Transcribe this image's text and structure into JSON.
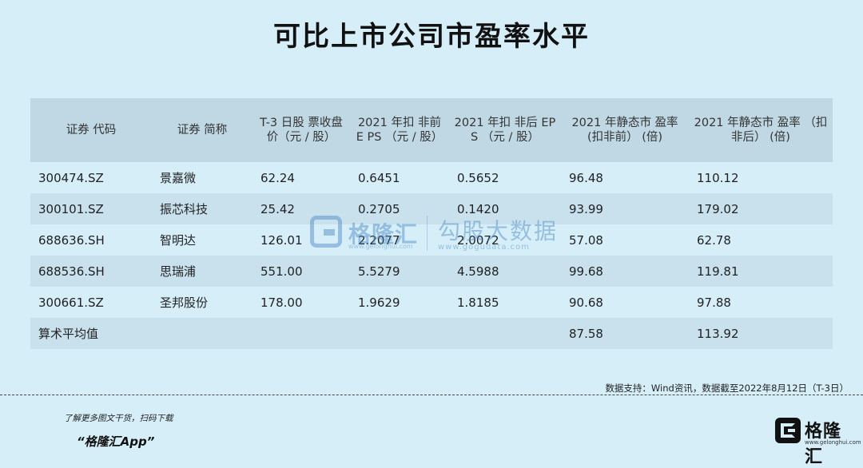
{
  "title": "可比上市公司市盈率水平",
  "table": {
    "headers": [
      "证券 代码",
      "证券 简称",
      "T-3 日股 票收盘 价（元 / 股）",
      "2021 年扣 非前 E PS （元 / 股）",
      "2021 年扣 非后 EP S （元 / 股）",
      "2021 年静态市 盈率 (扣非前） (倍)",
      "2021 年静态市 盈率 （扣 非后） (倍)"
    ],
    "rows": [
      [
        "300474.SZ",
        "景嘉微",
        "62.24",
        "0.6451",
        "0.5652",
        "96.48",
        "110.12"
      ],
      [
        "300101.SZ",
        "振芯科技",
        "25.42",
        "0.2705",
        "0.1420",
        "93.99",
        "179.02"
      ],
      [
        "688636.SH",
        "智明达",
        "126.01",
        "2.2077",
        "2.0072",
        "57.08",
        "62.78"
      ],
      [
        "688536.SH",
        "思瑞浦",
        "551.00",
        "5.5279",
        "4.5988",
        "99.68",
        "119.81"
      ],
      [
        "300661.SZ",
        "圣邦股份",
        "178.00",
        "1.9629",
        "1.8185",
        "90.68",
        "97.88"
      ]
    ],
    "average_row": {
      "label": "算术平均值",
      "static_pe_before": "87.58",
      "static_pe_after": "113.92"
    }
  },
  "watermark": {
    "name": "格隆汇",
    "sub": "勾股大数据",
    "url_left": "www.gelonghui.com",
    "url": "www.gogudata.com"
  },
  "source": "数据支持：Wind资讯，数据截至2022年8月12日（T-3日）",
  "footer": {
    "scan_text": "了解更多图文干货，扫码下载",
    "app_name": "“格隆汇App”",
    "logo_name": "格隆汇",
    "logo_url": "www.gelonghui.com"
  },
  "colors": {
    "background": "#d6eef8",
    "header_bg": "#bfd8e4",
    "stripe": "#c8e1ec",
    "watermark": "#4a86c6"
  }
}
